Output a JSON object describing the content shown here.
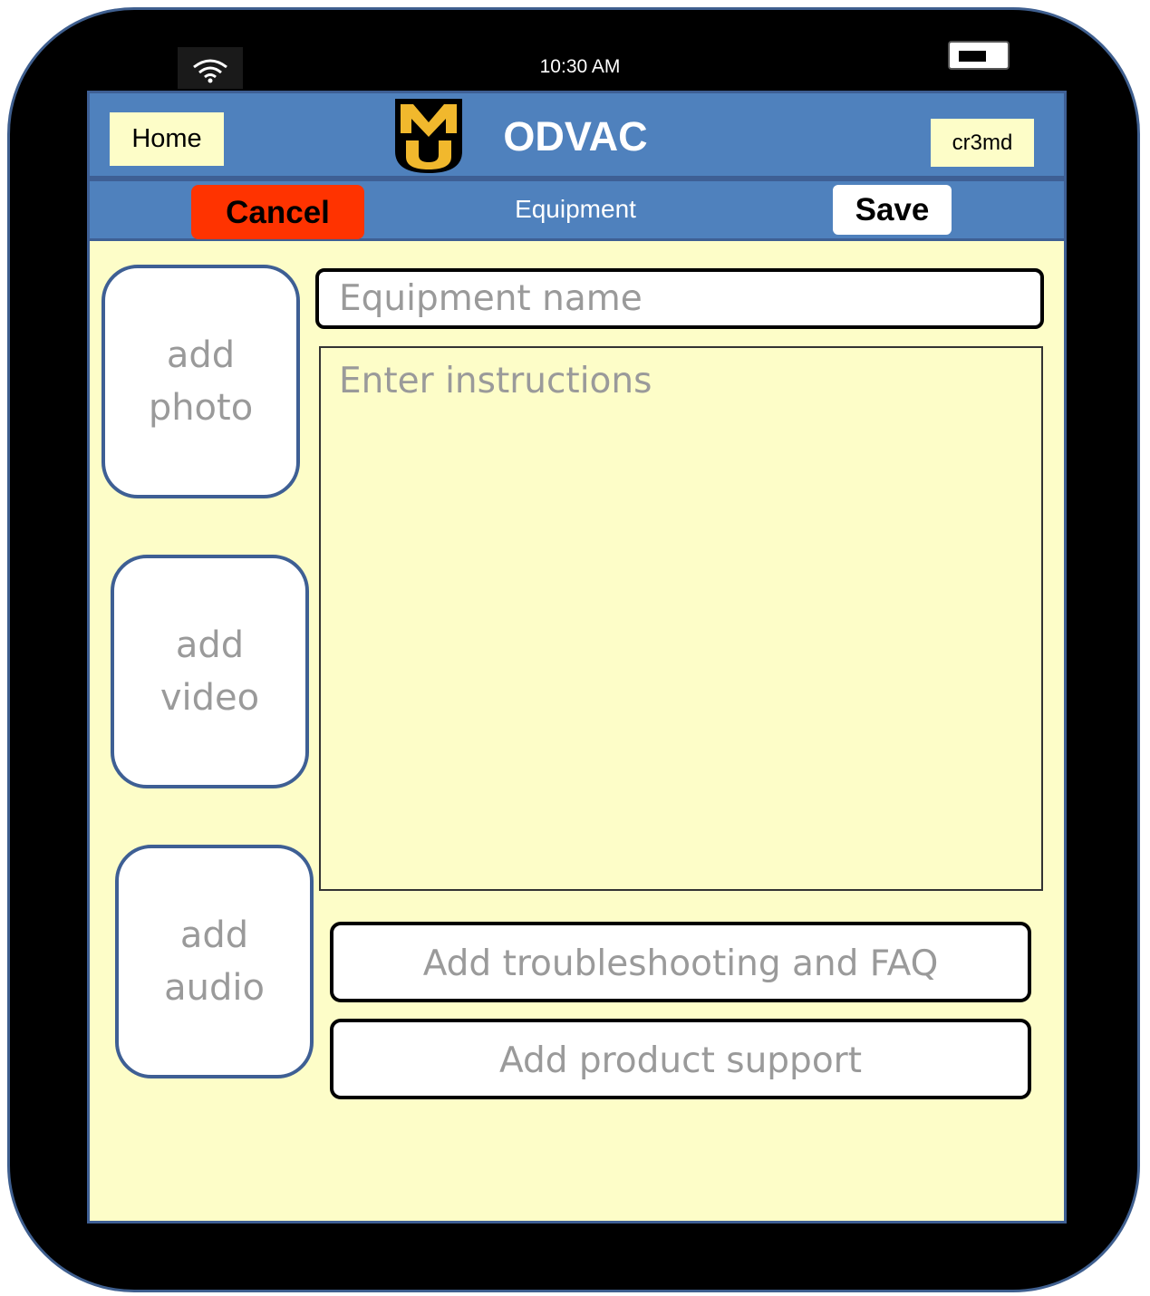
{
  "status_bar": {
    "time": "10:30 AM",
    "wifi_icon": "wifi-icon",
    "battery_icon": "battery-icon"
  },
  "header": {
    "home_label": "Home",
    "logo_icon": "mu-logo-icon",
    "app_title": "ODVAC",
    "user_label": "cr3md"
  },
  "toolbar": {
    "cancel_label": "Cancel",
    "page_title": "Equipment",
    "save_label": "Save"
  },
  "media": {
    "photo_label": "add photo",
    "video_label": "add video",
    "audio_label": "add audio"
  },
  "form": {
    "name_placeholder": "Equipment name",
    "name_value": "",
    "instructions_placeholder": "Enter instructions",
    "instructions_value": ""
  },
  "actions": {
    "faq_label": "Add troubleshooting and FAQ",
    "support_label": "Add product support"
  },
  "colors": {
    "header_blue": "#4f81bd",
    "screen_yellow": "#fdfdc8",
    "cancel_red": "#ff3300",
    "logo_gold": "#f1b82d"
  }
}
